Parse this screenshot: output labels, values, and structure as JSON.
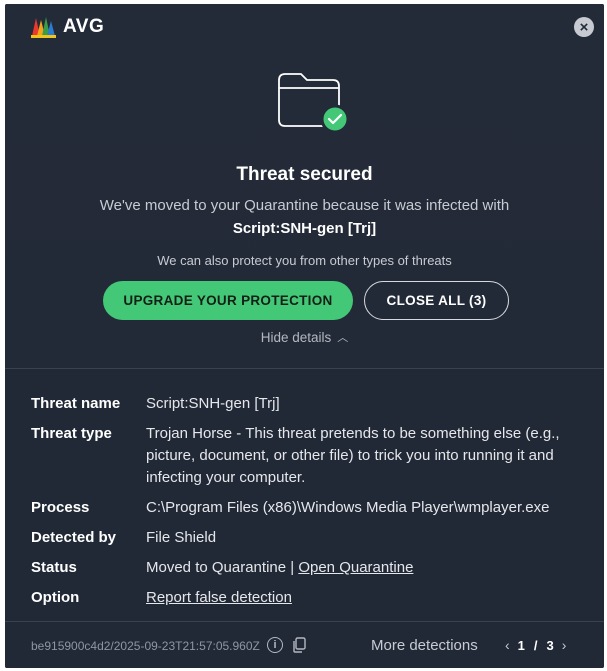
{
  "app": {
    "brand": "AVG",
    "close_icon": "close-icon"
  },
  "header": {
    "icon": "folder-check-icon",
    "title": "Threat secured",
    "message": "We've moved  to your Quarantine because it was infected with",
    "threat": "Script:SNH-gen [Trj]",
    "also_protect": "We can also protect you from other types of threats",
    "upgrade_label": "UPGRADE YOUR PROTECTION",
    "close_all_label": "CLOSE ALL (3)",
    "hide_details_label": "Hide details",
    "colors": {
      "background": "#232a38",
      "accent_green": "#43c878"
    }
  },
  "details": {
    "threat_name_key": "Threat name",
    "threat_name_val": "Script:SNH-gen [Trj]",
    "threat_type_key": "Threat type",
    "threat_type_line1": "Trojan Horse - This threat pretends to be something else (e.g.,",
    "threat_type_line2": "picture, document, or other file) to trick you into running it and",
    "threat_type_line3": "infecting your computer.",
    "process_key": "Process",
    "process_val": "C:\\Program Files (x86)\\Windows Media Player\\wmplayer.exe",
    "detected_key": "Detected by",
    "detected_val": "File Shield",
    "status_key": "Status",
    "status_val": "Moved to Quarantine | ",
    "status_link": "Open Quarantine",
    "option_key": "Option",
    "option_link": "Report false detection"
  },
  "footer": {
    "detection_id": "be915900c4d2/2025-09-23T21:57:05.960Z",
    "info_icon": "i",
    "more_detections": "More detections",
    "current_page": "1",
    "separator": "/",
    "total_pages": "3",
    "prev_arrow": "‹",
    "next_arrow": "›"
  }
}
